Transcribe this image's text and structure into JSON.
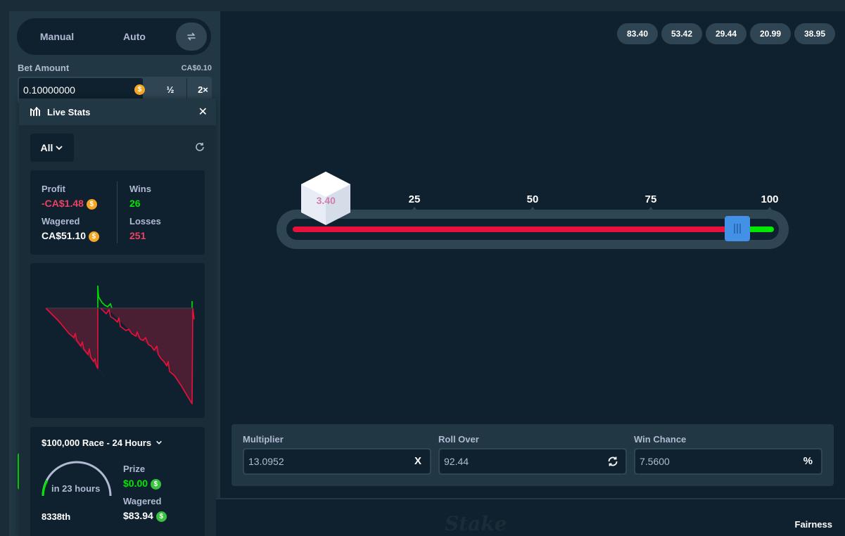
{
  "mode": {
    "manual_label": "Manual",
    "auto_label": "Auto"
  },
  "bet": {
    "label": "Bet Amount",
    "value_fiat": "CA$0.10",
    "amount": "0.10000000",
    "half_label": "½",
    "double_label": "2×"
  },
  "live_stats": {
    "title": "Live Stats",
    "filter": "All",
    "profit_label": "Profit",
    "profit_value": "-CA$1.48",
    "wagered_label": "Wagered",
    "wagered_value": "CA$51.10",
    "wins_label": "Wins",
    "wins_value": "26",
    "losses_label": "Losses",
    "losses_value": "251"
  },
  "race": {
    "title": "$100,000 Race - 24 Hours",
    "time_left": "in 23 hours",
    "rank": "8338th",
    "prize_label": "Prize",
    "prize_value": "$0.00",
    "wagered_label": "Wagered",
    "wagered_value": "$83.94"
  },
  "history": [
    "83.40",
    "53.42",
    "29.44",
    "20.99",
    "38.95"
  ],
  "slider": {
    "scale_labels": [
      "25",
      "50",
      "75",
      "100"
    ],
    "roll_over": 92.44,
    "last_roll": "3.40",
    "colors": {
      "lose": "#e9113c",
      "win": "#00e701",
      "handle": "#4391e7"
    }
  },
  "controls": {
    "multiplier_label": "Multiplier",
    "multiplier_value": "13.0952",
    "multiplier_suffix": "X",
    "roll_over_label": "Roll Over",
    "roll_over_value": "92.44",
    "win_chance_label": "Win Chance",
    "win_chance_value": "7.5600",
    "win_chance_suffix": "%"
  },
  "footer": {
    "logo": "Stake",
    "fairness_label": "Fairness"
  }
}
